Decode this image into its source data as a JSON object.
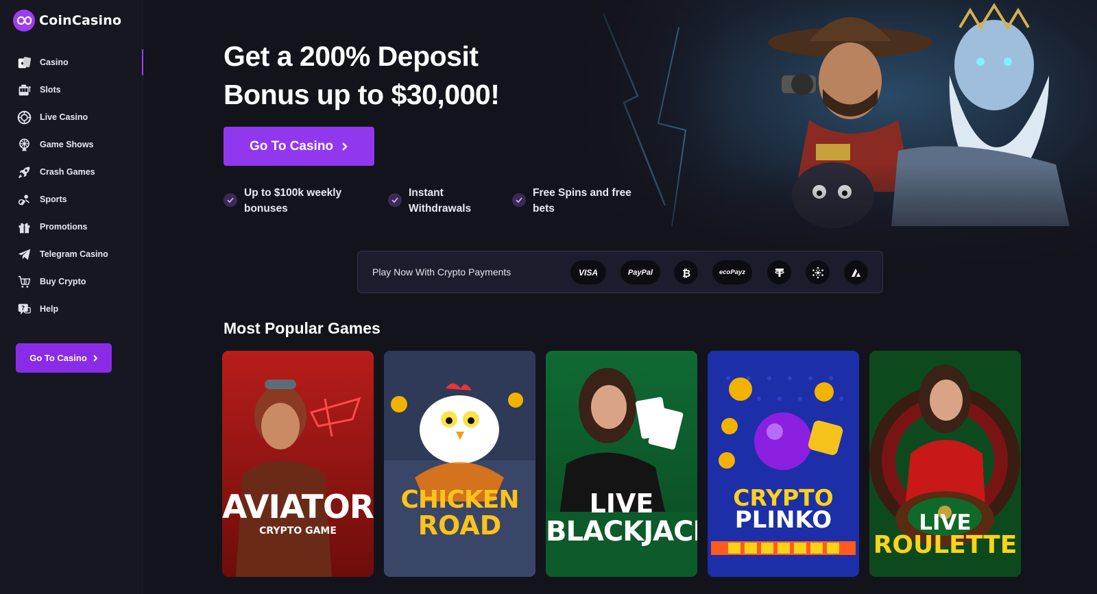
{
  "brand": {
    "name": "CoinCasino",
    "logo_icon": "infinity-coin-logo"
  },
  "sidebar": {
    "items": [
      {
        "label": "Casino",
        "icon": "casino-cards-icon",
        "active": true
      },
      {
        "label": "Slots",
        "icon": "slot-machine-icon",
        "active": false
      },
      {
        "label": "Live Casino",
        "icon": "poker-chip-icon",
        "active": false
      },
      {
        "label": "Game Shows",
        "icon": "prize-wheel-icon",
        "active": false
      },
      {
        "label": "Crash Games",
        "icon": "rocket-icon",
        "active": false
      },
      {
        "label": "Sports",
        "icon": "sports-icon",
        "active": false
      },
      {
        "label": "Promotions",
        "icon": "gift-icon",
        "active": false
      },
      {
        "label": "Telegram Casino",
        "icon": "telegram-icon",
        "active": false
      },
      {
        "label": "Buy Crypto",
        "icon": "buy-crypto-icon",
        "active": false
      },
      {
        "label": "Help",
        "icon": "help-chat-icon",
        "active": false
      }
    ],
    "cta_label": "Go To Casino"
  },
  "hero": {
    "title_line1": "Get a 200% Deposit",
    "title_line2": "Bonus up to $30,000!",
    "cta_label": "Go To Casino",
    "features": [
      {
        "line1": "Up to $100k weekly",
        "line2": "bonuses"
      },
      {
        "line1": "Instant",
        "line2": "Withdrawals"
      },
      {
        "line1": "Free Spins and free",
        "line2": "bets"
      }
    ]
  },
  "payments": {
    "label": "Play Now With Crypto Payments",
    "methods": [
      "VISA",
      "PayPal",
      "bitcoin-icon",
      "ecoPayz",
      "tether-icon",
      "cardano-icon",
      "avalanche-icon"
    ],
    "visa": "VISA",
    "paypal": "PayPal",
    "ecopayz": "ecoPayz"
  },
  "games_section": {
    "title": "Most Popular Games",
    "games": [
      {
        "title1": "AVIATOR",
        "title2": "CRYPTO GAME",
        "accent": "#e3231f"
      },
      {
        "title1": "CHICKEN",
        "title2": "ROAD",
        "accent": "#f2b300"
      },
      {
        "title1": "LIVE",
        "title2": "BLACKJACK",
        "accent": "#0b7a3a"
      },
      {
        "title1": "CRYPTO",
        "title2": "PLINKO",
        "accent": "#2a3fd6"
      },
      {
        "title1": "LIVE",
        "title2": "ROULETTE",
        "accent": "#0f6b2a"
      }
    ]
  },
  "colors": {
    "accent": "#9138ee",
    "sidebar_bg": "#171722",
    "page_bg": "#13131c"
  }
}
